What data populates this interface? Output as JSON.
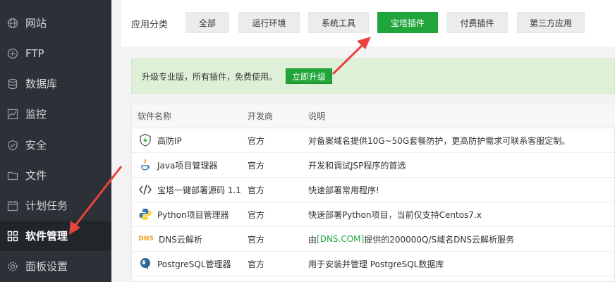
{
  "sidebar": {
    "items": [
      {
        "label": "网站",
        "icon": "globe-icon"
      },
      {
        "label": "FTP",
        "icon": "ftp-icon"
      },
      {
        "label": "数据库",
        "icon": "database-icon"
      },
      {
        "label": "监控",
        "icon": "monitor-icon"
      },
      {
        "label": "安全",
        "icon": "shield-icon"
      },
      {
        "label": "文件",
        "icon": "folder-icon"
      },
      {
        "label": "计划任务",
        "icon": "calendar-icon"
      },
      {
        "label": "软件管理",
        "icon": "grid-icon",
        "active": true
      },
      {
        "label": "面板设置",
        "icon": "gear-icon"
      }
    ]
  },
  "categories": {
    "label": "应用分类",
    "buttons": [
      "全部",
      "运行环境",
      "系统工具",
      "宝塔插件",
      "付费插件",
      "第三方应用"
    ],
    "active": "宝塔插件"
  },
  "promo": {
    "text": "升级专业版，所有插件，免费使用。",
    "button": "立即升级"
  },
  "table": {
    "headers": [
      "软件名称",
      "开发商",
      "说明"
    ],
    "rows": [
      {
        "name": "高防IP",
        "icon": "shield-bolt-icon",
        "dev": "官方",
        "desc": "对备案域名提供10G~50G套餐防护，更高防护需求可联系客服定制。"
      },
      {
        "name": "Java项目管理器",
        "icon": "java-icon",
        "dev": "官方",
        "desc": "开发和调试JSP程序的首选"
      },
      {
        "name": "宝塔一键部署源码 1.1",
        "icon": "code-icon",
        "dev": "官方",
        "desc": "快速部署常用程序!"
      },
      {
        "name": "Python项目管理器",
        "icon": "python-icon",
        "dev": "官方",
        "desc": "快速部署Python项目，当前仅支持Centos7.x"
      },
      {
        "name": "DNS云解析",
        "icon": "dns-icon",
        "dev": "官方",
        "desc_pre": "由",
        "desc_link": "[DNS.COM]",
        "desc_post": "提供的200000Q/S域名DNS云解析服务"
      },
      {
        "name": "PostgreSQL管理器",
        "icon": "postgresql-icon",
        "dev": "官方",
        "desc": "用于安装并管理 PostgreSQL数据库"
      }
    ]
  },
  "colors": {
    "accent": "#20a53a",
    "sidebar_bg": "#2c3138",
    "arrow": "#e8433c"
  },
  "dns_badge": "DNS"
}
